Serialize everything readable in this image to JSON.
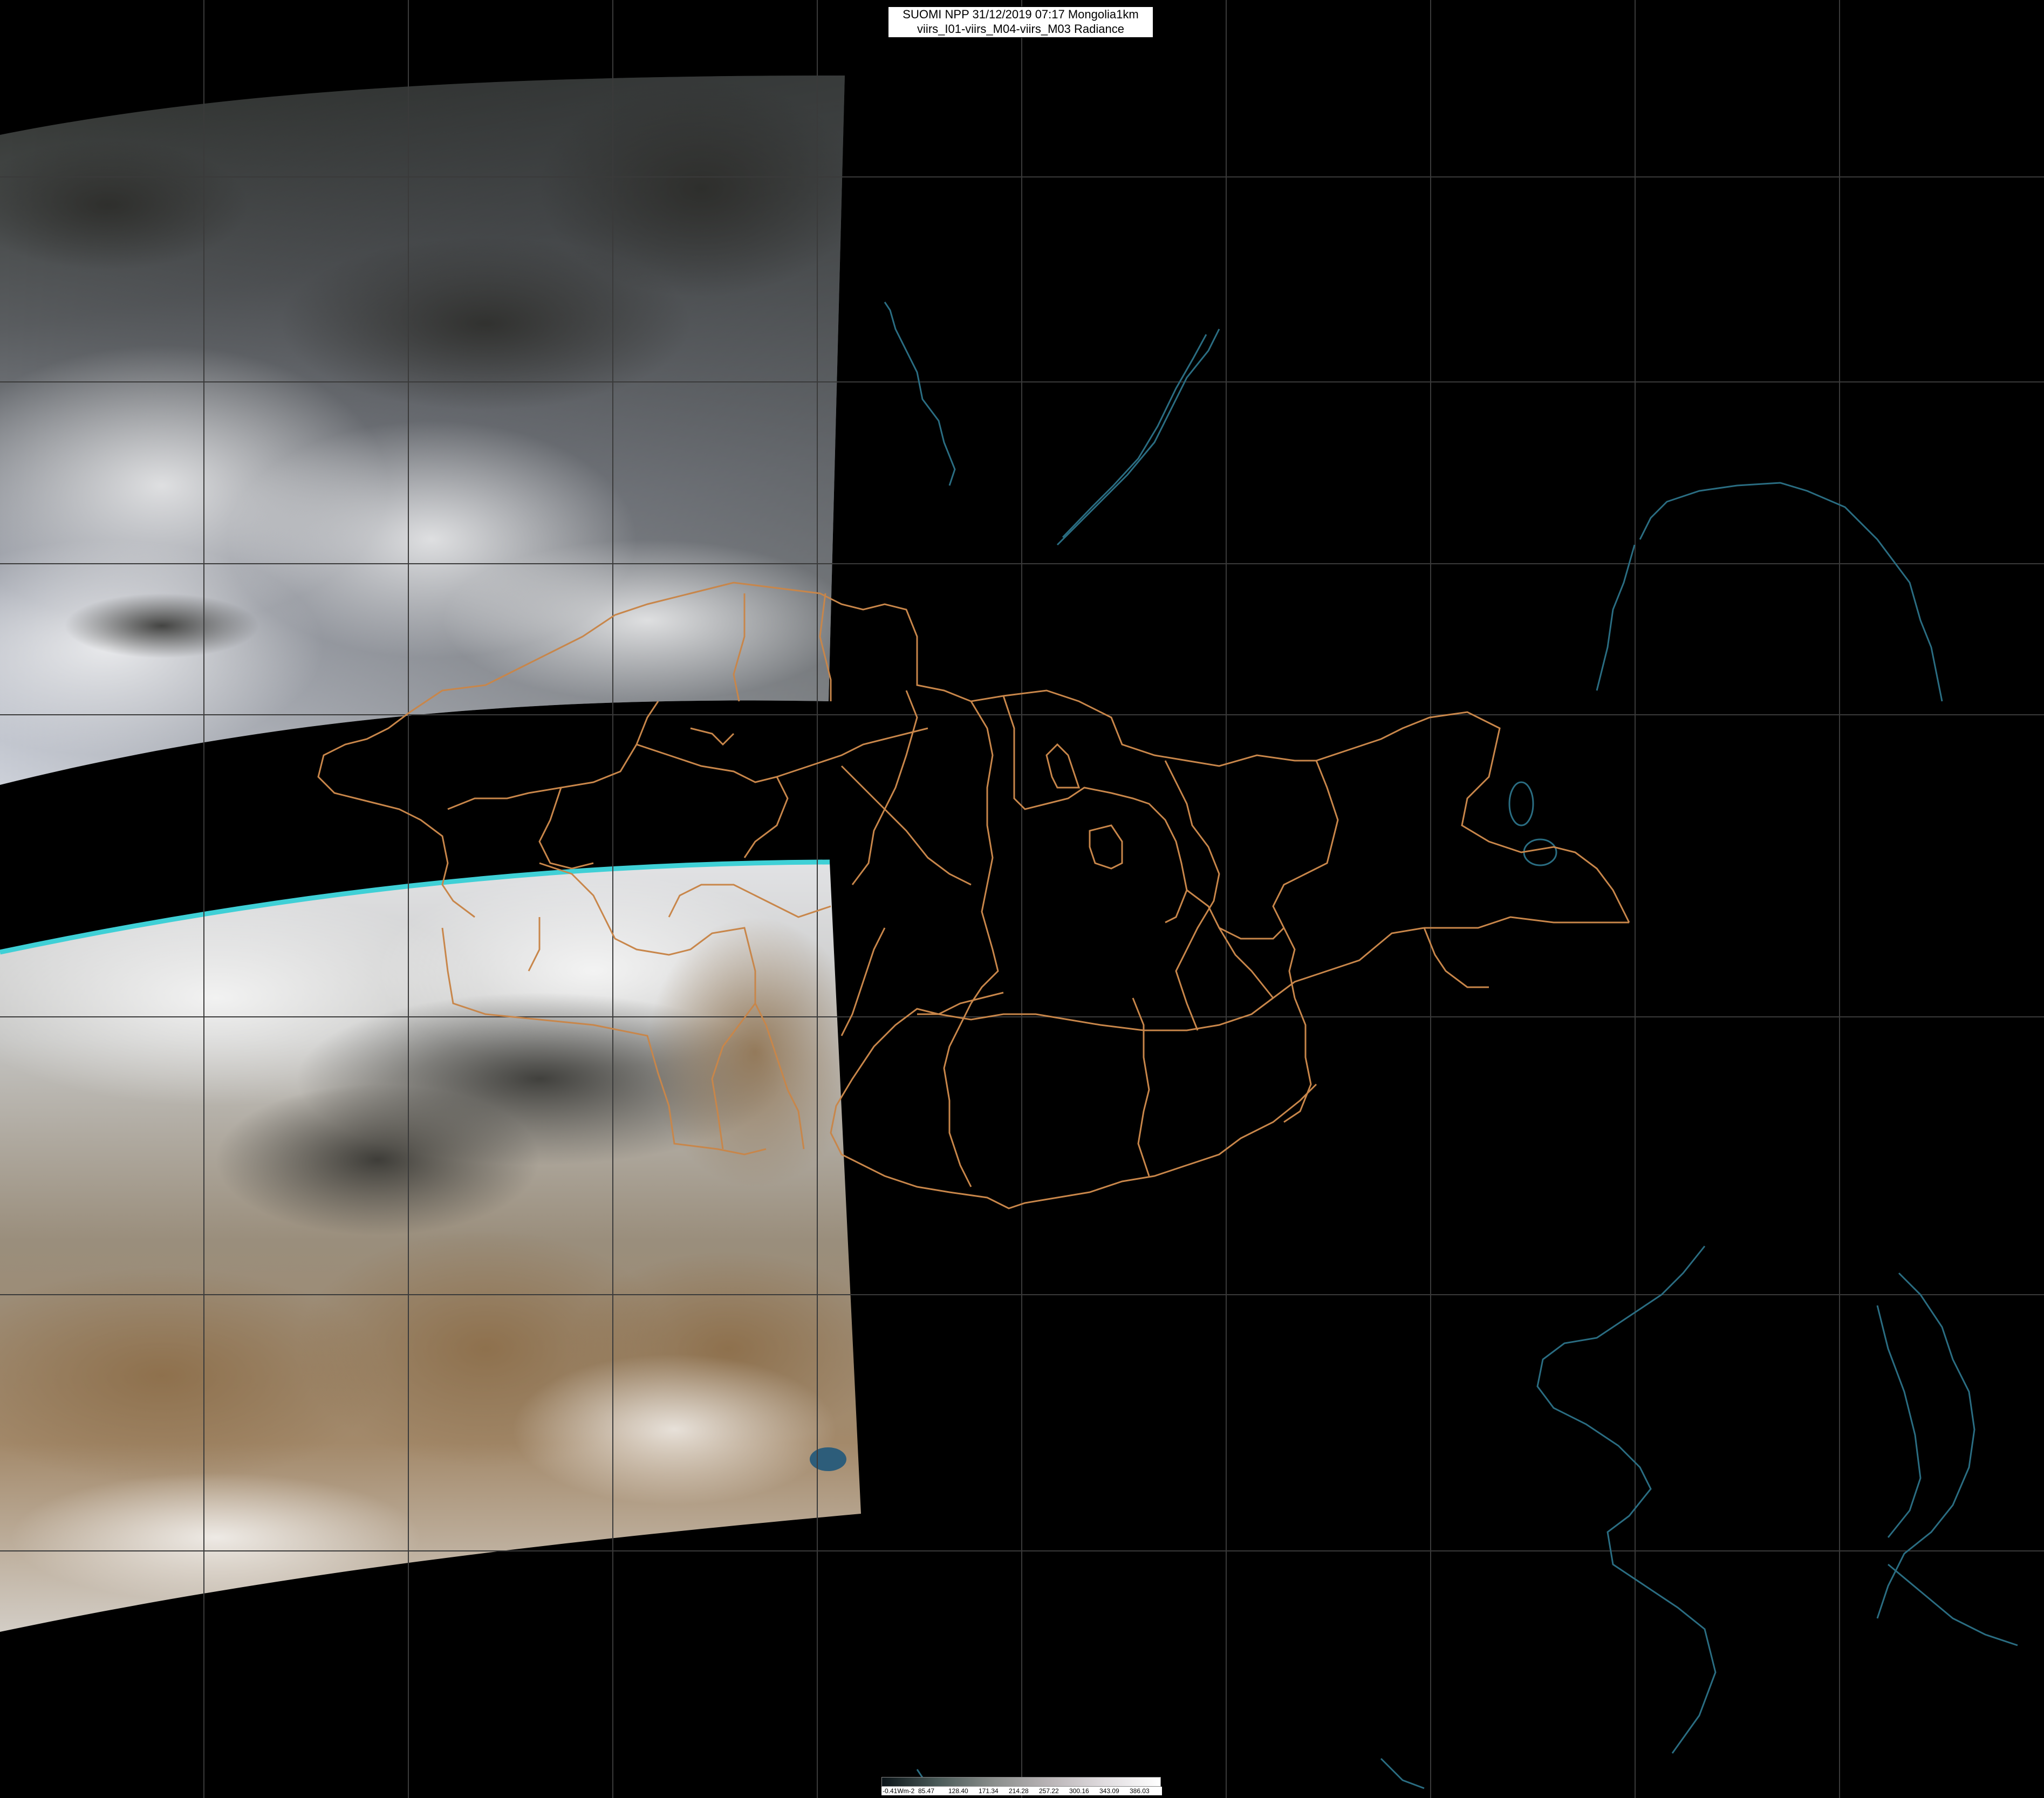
{
  "header": {
    "line1": "SUOMI NPP 31/12/2019 07:17 Mongolia1km",
    "line2": "viirs_I01-viirs_M04-viirs_M03 Radiance"
  },
  "colorbar": {
    "labels": [
      "-0.41Wm-2",
      "85.47",
      "128.40",
      "171.34",
      "214.28",
      "257.22",
      "300.16",
      "343.09",
      "386.03"
    ],
    "gradient_colors": [
      "#0b1418",
      "#4a5a58",
      "#8a8e8c",
      "#b9b4b6",
      "#e0dcdf",
      "#ffffff"
    ]
  },
  "colors": {
    "background": "#000000",
    "grid": "#3a3a3a",
    "admin_boundaries": "#c8864a",
    "coastlines": "#2a6d82",
    "swath_edge": "#3fd0d6"
  }
}
